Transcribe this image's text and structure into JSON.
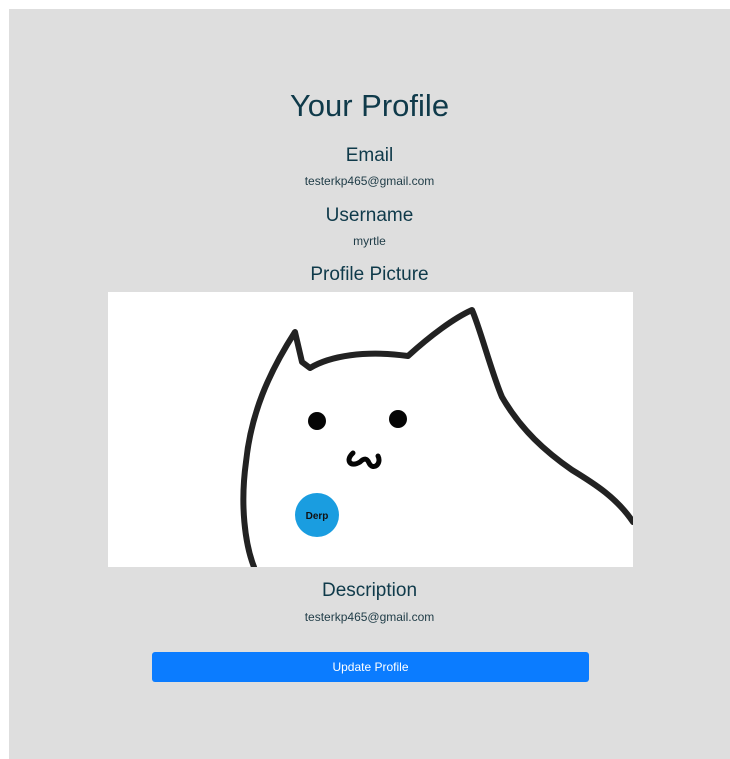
{
  "profile": {
    "title": "Your Profile",
    "email_heading": "Email",
    "email_value": "testerkp465@gmail.com",
    "username_heading": "Username",
    "username_value": "myrtle",
    "picture_heading": "Profile Picture",
    "picture": {
      "badge_text": "Derp",
      "badge_color": "#1a9de0"
    },
    "description_heading": "Description",
    "description_value": "testerkp465@gmail.com"
  },
  "actions": {
    "update_label": "Update Profile",
    "button_color": "#0b7cff"
  },
  "theme": {
    "panel_background": "#dedede",
    "text_color": "#0f3a4a"
  }
}
